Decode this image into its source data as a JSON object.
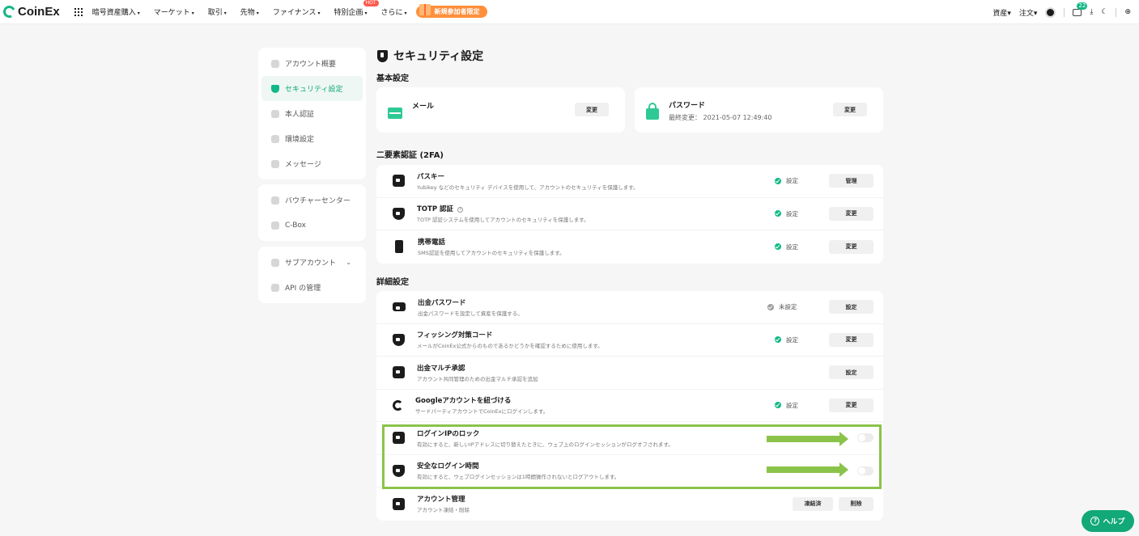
{
  "brand": {
    "name": "CoinEx",
    "accent": "#12b886"
  },
  "topnav": {
    "items": [
      {
        "label": "暗号資産購入",
        "caret": "▾"
      },
      {
        "label": "マーケット",
        "caret": "▾"
      },
      {
        "label": "取引",
        "caret": "▾"
      },
      {
        "label": "先物",
        "caret": "▾"
      },
      {
        "label": "ファイナンス",
        "caret": "▾"
      },
      {
        "label": "特別企画",
        "caret": "▾",
        "badge": "HOT"
      },
      {
        "label": "さらに",
        "caret": "▾"
      }
    ],
    "promo": "新規参加者限定",
    "right": {
      "assets": "資産▾",
      "orders": "注文▾",
      "message_count": "22"
    }
  },
  "sidebar": {
    "group1": [
      {
        "label": "アカウント概要",
        "icon": "user-icon"
      },
      {
        "label": "セキュリティ設定",
        "icon": "shield-icon",
        "active": true
      },
      {
        "label": "本人認証",
        "icon": "id-icon"
      },
      {
        "label": "環境設定",
        "icon": "gear-icon"
      },
      {
        "label": "メッセージ",
        "icon": "mail-icon"
      }
    ],
    "group2": [
      {
        "label": "バウチャーセンター",
        "icon": "voucher-icon"
      },
      {
        "label": "C-Box",
        "icon": "box-icon"
      }
    ],
    "group3": [
      {
        "label": "サブアカウント",
        "icon": "users-icon",
        "expand": "⌄"
      },
      {
        "label": "API の管理",
        "icon": "api-icon"
      }
    ]
  },
  "main": {
    "title": "セキュリティ設定",
    "basic_title": "基本設定",
    "email": {
      "label": "メール",
      "button": "変更"
    },
    "password": {
      "label": "パスワード",
      "sub": "最終変更： 2021-05-07 12:49:40",
      "button": "変更"
    },
    "twofa_title": "二要素認証 (2FA)",
    "twofa": [
      {
        "name": "パスキー",
        "desc": "Yubikey などのセキュリティ デバイスを使用して、アカウントのセキュリティを保護します。",
        "status": "設定",
        "button": "管理"
      },
      {
        "name": "TOTP 認証",
        "info": "?",
        "desc": "TOTP 認証システムを使用してアカウントのセキュリティを保護します。",
        "status": "設定",
        "button": "変更"
      },
      {
        "name": "携帯電話",
        "desc": "SMS認証を使用してアカウントのセキュリティを保護します。",
        "status": "設定",
        "button": "変更"
      }
    ],
    "advanced_title": "詳細設定",
    "advanced": [
      {
        "name": "出金パスワード",
        "desc": "出金パスワードを設定して資産を保護する。",
        "status": "未設定",
        "button": "設定"
      },
      {
        "name": "フィッシング対策コード",
        "desc": "メールがCoinEx公式からのものであるかどうかを確認するために使用します。",
        "status": "設定",
        "button": "変更"
      },
      {
        "name": "出金マルチ承認",
        "desc": "アカウント共同管理のための出金マルチ承認を追加",
        "button": "設定"
      },
      {
        "name": "Googleアカウントを紐づける",
        "desc": "サードパーティアカウントでCoinExにログインします。",
        "status": "設定",
        "button": "変更"
      },
      {
        "name": "ログインIPのロック",
        "desc": "有効にすると、新しいIPアドレスに切り替えたときに、ウェブ上のログインセッションがログオフされます。",
        "toggle": false
      },
      {
        "name": "安全なログイン時間",
        "desc": "有効にすると、ウェブログインセッションは1時間操作されないとログアウトします。",
        "toggle": false
      },
      {
        "name": "アカウント管理",
        "desc": "アカウント凍結・削除",
        "button_freeze": "凍結済",
        "button_delete": "削除"
      }
    ]
  },
  "help": {
    "label": "ヘルプ",
    "icon": "?"
  },
  "annotation": {
    "highlight_color": "#8bc34a"
  }
}
